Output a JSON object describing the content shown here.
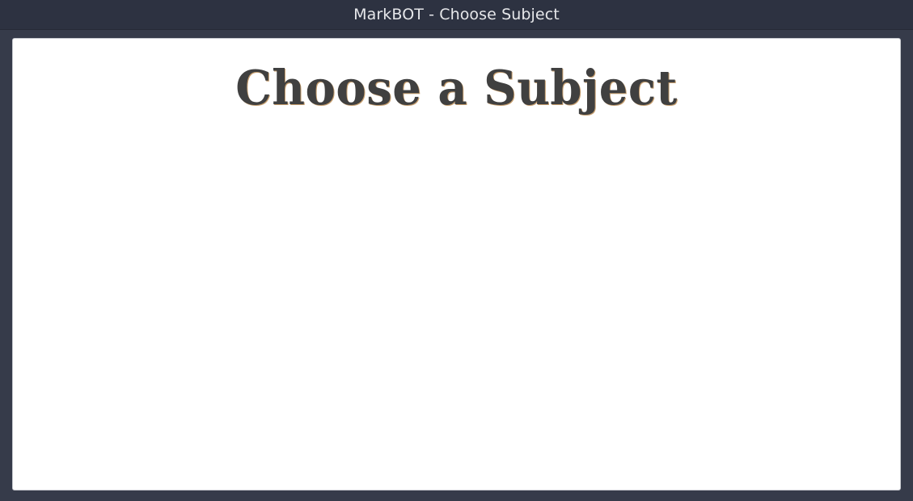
{
  "window": {
    "title": "MarkBOT - Choose Subject"
  },
  "main": {
    "heading": "Choose a Subject"
  },
  "colors": {
    "titlebar": "#2d3241",
    "frame": "#363b4a",
    "content_bg": "#ffffff",
    "heading_text": "#404040"
  }
}
